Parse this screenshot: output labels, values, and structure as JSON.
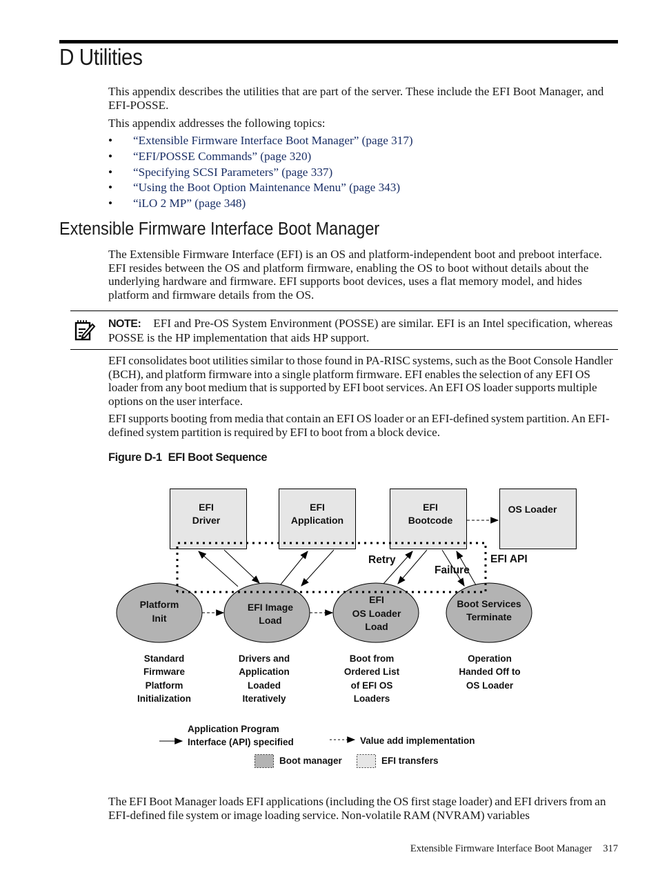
{
  "chapter": {
    "title": "D Utilities",
    "intro": "This appendix describes the utilities that are part of the server. These include the EFI Boot Manager, and EFI-POSSE.",
    "topics_lead": "This appendix addresses the following topics:",
    "topics": [
      {
        "label": "“Extensible Firmware Interface Boot Manager” (page 317)"
      },
      {
        "label": "“EFI/POSSE Commands” (page 320)"
      },
      {
        "label": "“Specifying SCSI Parameters” (page 337)"
      },
      {
        "label": "“Using the Boot Option Maintenance Menu” (page 343)"
      },
      {
        "label": "“iLO 2 MP” (page 348)"
      }
    ],
    "bullet_glyph": "•"
  },
  "section": {
    "title": "Extensible Firmware Interface Boot Manager",
    "para1": "The Extensible Firmware Interface (EFI) is an OS and platform-independent boot and preboot interface. EFI resides between the OS and platform firmware, enabling the OS to boot without details about the underlying hardware and firmware. EFI supports boot devices, uses a flat memory model, and hides platform and firmware details from the OS.",
    "note": {
      "icon": "note-pencil-icon",
      "label": "NOTE:",
      "text": "EFI and Pre-OS System Environment (POSSE) are similar. EFI is an Intel specification, whereas POSSE is the HP implementation that aids HP support."
    },
    "para2": "EFI consolidates boot utilities similar to those found in PA-RISC systems, such as the Boot Console Handler (BCH), and platform firmware into a single platform firmware. EFI enables the selection of any EFI OS loader from any boot medium that is supported by EFI boot services. An EFI OS loader supports multiple options on the user interface.",
    "para3": "EFI supports booting from media that contain an EFI OS loader or an EFI-defined system partition. An EFI-defined system partition is required by EFI to boot from a block device.",
    "para4": "The EFI Boot Manager loads EFI applications (including the OS first stage loader) and EFI drivers from an EFI-defined file system or image loading service. Non-volatile RAM (NVRAM) variables"
  },
  "figure": {
    "number": "Figure  D-1",
    "title": "EFI Boot Sequence",
    "colors": {
      "transfer_box": "#e6e6e6",
      "boot_manager": "#b3b3b3",
      "line": "#000000"
    },
    "boxes": [
      {
        "id": "efi-driver",
        "lines": [
          "EFI",
          "Driver"
        ]
      },
      {
        "id": "efi-application",
        "lines": [
          "EFI",
          "Application"
        ]
      },
      {
        "id": "efi-bootcode",
        "lines": [
          "EFI",
          "Bootcode"
        ]
      },
      {
        "id": "os-loader",
        "lines": [
          "OS Loader"
        ]
      }
    ],
    "stages": [
      {
        "id": "platform-init",
        "lines": [
          "Platform",
          "Init"
        ],
        "caption": [
          "Standard",
          "Firmware",
          "Platform",
          "Initialization"
        ]
      },
      {
        "id": "efi-image-load",
        "lines": [
          "EFI Image",
          "Load"
        ],
        "caption": [
          "Drivers and",
          "Application",
          "Loaded",
          "Iteratively"
        ]
      },
      {
        "id": "efi-os-loader-load",
        "lines": [
          "EFI",
          "OS Loader",
          "Load"
        ],
        "caption": [
          "Boot from",
          "Ordered List",
          "of EFI OS",
          "Loaders"
        ]
      },
      {
        "id": "boot-services-terminate",
        "lines": [
          "Boot Services",
          "Terminate"
        ],
        "caption": [
          "Operation",
          "Handed Off to",
          "OS Loader"
        ]
      }
    ],
    "labels": {
      "retry": "Retry",
      "failure": "Failure",
      "efi_api": "EFI API"
    },
    "legend": {
      "api_specified": [
        "Application Program",
        "Interface (API) specified"
      ],
      "value_add": "Value add implementation",
      "boot_manager": "Boot manager",
      "efi_transfers": "EFI transfers"
    }
  },
  "footer": {
    "section": "Extensible Firmware Interface Boot Manager",
    "page": "317"
  }
}
